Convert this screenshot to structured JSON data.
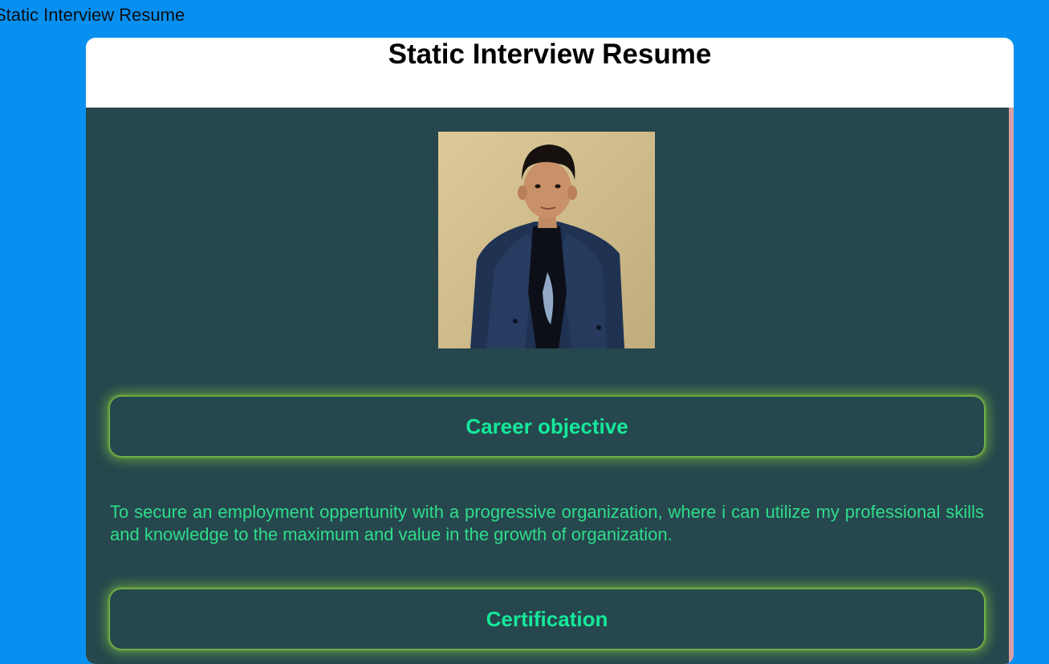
{
  "page": {
    "caption": "Static Interview Resume"
  },
  "resume": {
    "title": "Static Interview Resume",
    "sections": [
      {
        "heading": "Career objective",
        "body": "To secure an employment oppertunity with a progressive organization, where i can utilize my professional skills and knowledge to the maximum and value in the growth of organization."
      },
      {
        "heading": "Certification"
      }
    ]
  },
  "colors": {
    "page_background": "#0890f0",
    "panel_background": "#26474d",
    "heading_text": "#15e89a",
    "body_text": "#2fdc8c",
    "glow": "#96e63c"
  }
}
